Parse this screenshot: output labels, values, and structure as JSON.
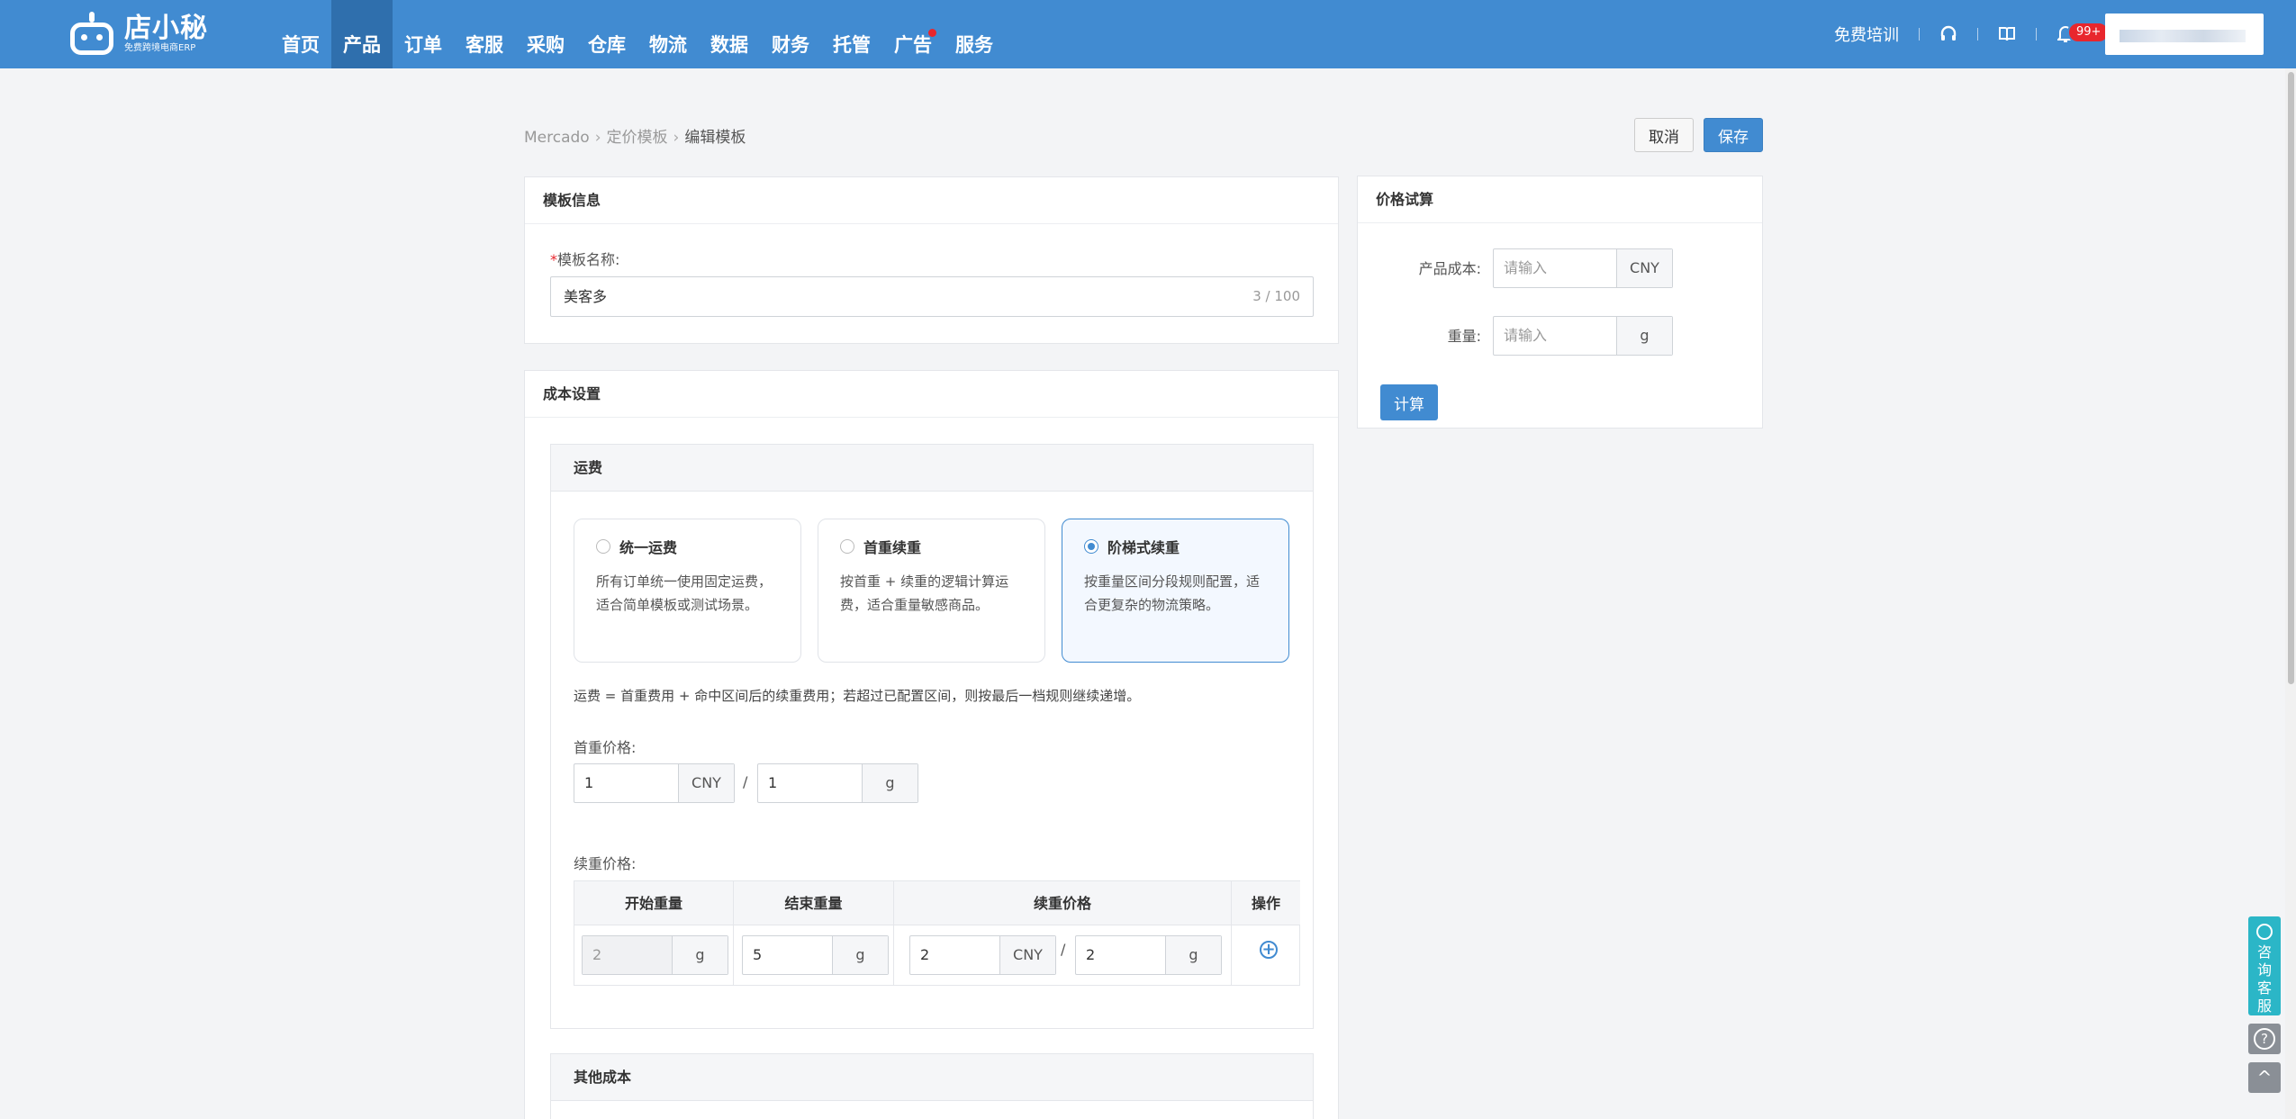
{
  "logo": {
    "name": "店小秘",
    "tagline": "免费跨境电商ERP"
  },
  "nav": {
    "items": [
      {
        "label": "首页"
      },
      {
        "label": "产品"
      },
      {
        "label": "订单"
      },
      {
        "label": "客服"
      },
      {
        "label": "采购"
      },
      {
        "label": "仓库"
      },
      {
        "label": "物流"
      },
      {
        "label": "数据"
      },
      {
        "label": "财务"
      },
      {
        "label": "托管"
      },
      {
        "label": "广告"
      },
      {
        "label": "服务"
      }
    ],
    "active": "产品",
    "training": "免费培训",
    "notification_badge": "99+",
    "icons": [
      "headset-icon",
      "book-icon",
      "bell-icon"
    ]
  },
  "breadcrumb": {
    "items": [
      "Mercado",
      "定价模板"
    ],
    "current": "编辑模板"
  },
  "actions": {
    "cancel": "取消",
    "save": "保存"
  },
  "template_info": {
    "title": "模板信息",
    "name_label": "模板名称",
    "required_mark": "*",
    "label_colon": ":",
    "name_value": "美客多",
    "name_count": "3 / 100"
  },
  "cost_settings": {
    "title": "成本设置",
    "freight": {
      "title": "运费",
      "options": [
        {
          "title": "统一运费",
          "desc": "所有订单统一使用固定运费，适合简单模板或测试场景。",
          "selected": false
        },
        {
          "title": "首重续重",
          "desc": "按首重 + 续重的逻辑计算运费，适合重量敏感商品。",
          "selected": false
        },
        {
          "title": "阶梯式续重",
          "desc": "按重量区间分段规则配置，适合更复杂的物流策略。",
          "selected": true
        }
      ],
      "formula": "运费 = 首重费用 + 命中区间后的续重费用；若超过已配置区间，则按最后一档规则继续递增。",
      "first_weight_label": "首重价格",
      "first_price": {
        "value": "1",
        "unit": "CNY"
      },
      "first_weight": {
        "value": "1",
        "unit": "g"
      },
      "slash": "/",
      "continued_label": "续重价格",
      "table": {
        "headers": [
          "开始重量",
          "结束重量",
          "续重价格",
          "操作"
        ],
        "rows": [
          {
            "start": {
              "value": "2",
              "unit": "g"
            },
            "end": {
              "value": "5",
              "unit": "g"
            },
            "price": {
              "value": "2",
              "unit": "CNY"
            },
            "per_weight": {
              "value": "2",
              "unit": "g"
            }
          }
        ]
      }
    },
    "other": {
      "title": "其他成本"
    }
  },
  "price_calc": {
    "title": "价格试算",
    "cost_label": "产品成本",
    "cost_placeholder": "请输入",
    "cost_unit": "CNY",
    "weight_label": "重量",
    "weight_placeholder": "请输入",
    "weight_unit": "g",
    "calc_button": "计算"
  },
  "float": {
    "customer_service": "咨询客服",
    "help": "?",
    "top": "^"
  },
  "colors": {
    "primary": "#418bd1",
    "nav_active": "#2f6fad",
    "badge": "#e8262d",
    "cs": "#2bb6c7"
  }
}
